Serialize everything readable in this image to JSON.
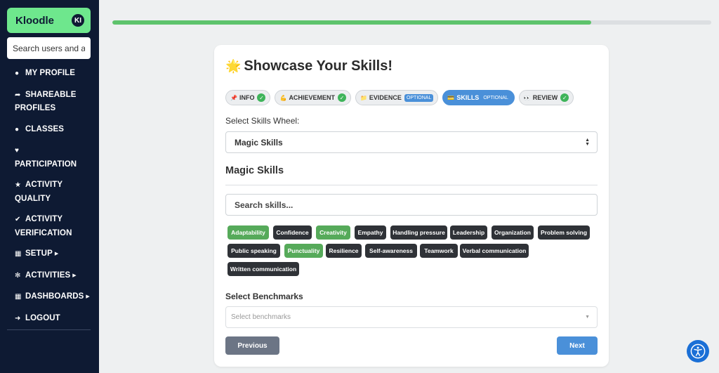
{
  "sidebar": {
    "brand": "Kloodle",
    "badge": "KI",
    "search_placeholder": "Search users and a",
    "items": [
      {
        "label": "MY PROFILE",
        "icon": "user-icon"
      },
      {
        "label": "SHAREABLE PROFILES",
        "icon": "share-icon"
      },
      {
        "label": "CLASSES",
        "icon": "users-icon"
      },
      {
        "label": "PARTICIPATION",
        "icon": "heart-icon"
      },
      {
        "label": "ACTIVITY QUALITY",
        "icon": "star-icon"
      },
      {
        "label": "ACTIVITY VERIFICATION",
        "icon": "check-circle-icon"
      },
      {
        "label": "SETUP",
        "icon": "grid-icon",
        "has_caret": true
      },
      {
        "label": "ACTIVITIES",
        "icon": "running-icon",
        "has_caret": true
      },
      {
        "label": "DASHBOARDS",
        "icon": "chart-icon",
        "has_caret": true
      },
      {
        "label": "LOGOUT",
        "icon": "logout-icon"
      }
    ]
  },
  "progress": {
    "value_percent": 80
  },
  "card": {
    "title": "Showcase Your Skills!",
    "title_icon": "star-icon",
    "steps": [
      {
        "label": "INFO",
        "icon": "pin-icon",
        "done": true
      },
      {
        "label": "ACHIEVEMENT",
        "icon": "muscle-icon",
        "done": true
      },
      {
        "label": "EVIDENCE",
        "icon": "folder-icon",
        "optional": "OPTIONAL"
      },
      {
        "label": "SKILLS",
        "icon": "id-card-icon",
        "optional": "OPTIONAL",
        "active": true
      },
      {
        "label": "REVIEW",
        "icon": "eyes-icon",
        "done": true
      }
    ],
    "wheel_label": "Select Skills Wheel:",
    "wheel_value": "Magic Skills",
    "wheel_heading": "Magic Skills",
    "skill_search_placeholder": "Search skills...",
    "skills": [
      {
        "label": "Adaptability",
        "selected": true
      },
      {
        "label": "Confidence",
        "selected": false
      },
      {
        "label": "Creativity",
        "selected": true
      },
      {
        "label": "Empathy",
        "selected": false
      },
      {
        "label": "Handling pressure",
        "selected": false
      },
      {
        "label": "Leadership",
        "selected": false
      },
      {
        "label": "Organization",
        "selected": false
      },
      {
        "label": "Problem solving",
        "selected": false
      },
      {
        "label": "Public speaking",
        "selected": false
      },
      {
        "label": "Punctuality",
        "selected": true
      },
      {
        "label": "Resilience",
        "selected": false
      },
      {
        "label": "Self-awareness",
        "selected": false
      },
      {
        "label": "Teamwork",
        "selected": false
      },
      {
        "label": "Verbal communication",
        "selected": false
      },
      {
        "label": "Written communication",
        "selected": false
      }
    ],
    "benchmarks_label": "Select Benchmarks",
    "benchmarks_placeholder": "Select benchmarks",
    "prev_label": "Previous",
    "next_label": "Next"
  },
  "colors": {
    "sidebar_bg": "#0e1a33",
    "brand_green": "#6ee78d",
    "accent_blue": "#4a90d9",
    "selected_green": "#56aa5a",
    "unselected_dark": "#2f3237"
  }
}
